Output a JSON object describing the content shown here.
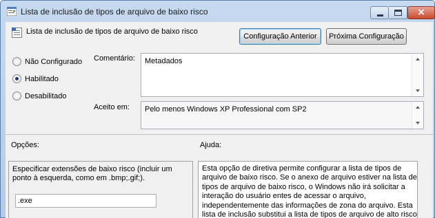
{
  "window": {
    "title": "Lista de inclusão de tipos de arquivo de baixo risco",
    "close_glyph": "×",
    "accent": "#3c7fb1"
  },
  "header": {
    "policy_title": "Lista de inclusão de tipos de arquivo de baixo risco",
    "prev_button": "Configuração Anterior",
    "next_button": "Próxima Configuração"
  },
  "state": {
    "options": [
      {
        "label": "Não Configurado",
        "checked": false
      },
      {
        "label": "Habilitado",
        "checked": true
      },
      {
        "label": "Desabilitado",
        "checked": false
      }
    ]
  },
  "comment": {
    "label": "Comentário:",
    "value": "Metadados"
  },
  "supported": {
    "label": "Aceito em:",
    "value": "Pelo menos Windows XP Professional com SP2"
  },
  "options_section": {
    "label": "Opções:",
    "description_line1": "Especificar extensões de baixo risco (incluir um",
    "description_line2": "ponto à esquerda, como em .bmp;.gif;).",
    "input_value": ".exe"
  },
  "help_section": {
    "label": "Ajuda:",
    "lines": [
      "Esta opção de diretiva permite configurar a lista de tipos de",
      "arquivo de baixo risco. Se o anexo de arquivo estiver na lista de",
      "tipos de arquivo de baixo risco, o Windows não irá solicitar a",
      "interação do usuário entes de acessar o arquivo,",
      "independentemente das informações de zona do arquivo. Esta",
      "lista de inclusão substitui a lista de tipos de arquivo de alto risco"
    ]
  }
}
